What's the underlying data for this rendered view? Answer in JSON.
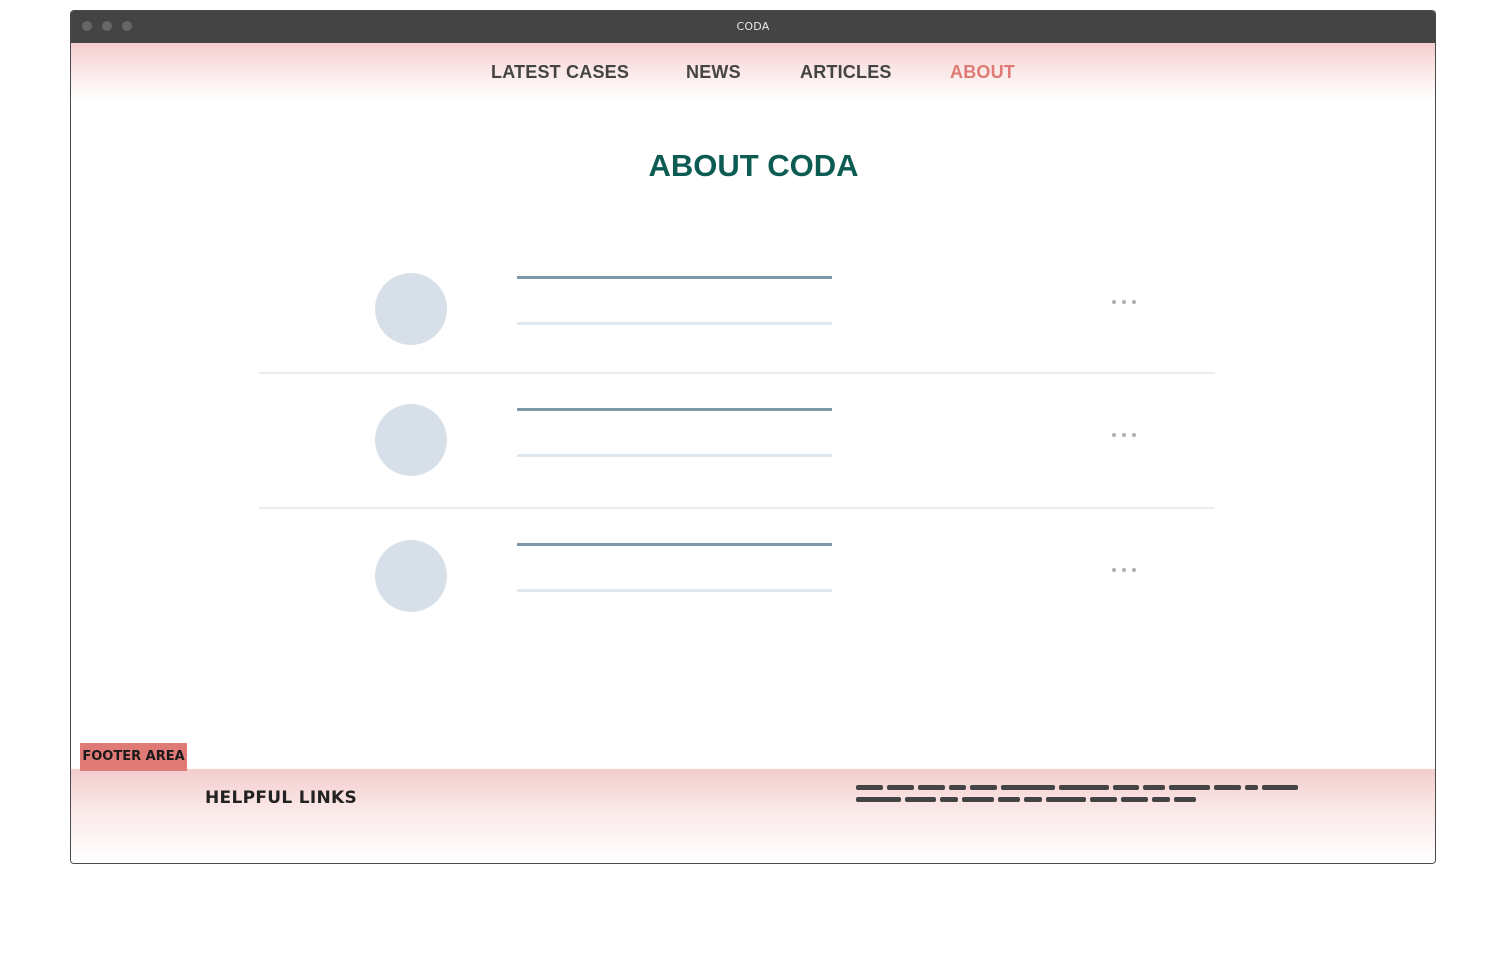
{
  "window": {
    "title": "CODA"
  },
  "nav": {
    "items": [
      {
        "label": "LATEST CASES",
        "active": false
      },
      {
        "label": "NEWS",
        "active": false
      },
      {
        "label": "ARTICLES",
        "active": false
      },
      {
        "label": "ABOUT",
        "active": true
      }
    ]
  },
  "main": {
    "title": "ABOUT CODA",
    "rows": [
      {
        "avatar": "placeholder-avatar",
        "title_line": "placeholder-line",
        "subtitle_line": "placeholder-line",
        "action_icon": "more-horizontal-icon"
      },
      {
        "avatar": "placeholder-avatar",
        "title_line": "placeholder-line",
        "subtitle_line": "placeholder-line",
        "action_icon": "more-horizontal-icon"
      },
      {
        "avatar": "placeholder-avatar",
        "title_line": "placeholder-line",
        "subtitle_line": "placeholder-line",
        "action_icon": "more-horizontal-icon"
      }
    ]
  },
  "footer": {
    "area_label": "FOOTER AREA",
    "helpful_links_label": "HELPFUL LINKS",
    "placeholder_text": "scribble-text-placeholder"
  },
  "colors": {
    "titlebar": "#444444",
    "nav_active": "#e07a76",
    "nav_text": "#444444",
    "heading": "#0d5c54",
    "gradient_pink": "#f4cccc",
    "footer_tag": "#e07a76",
    "avatar": "#d7e0e8",
    "title_line": "#7d99a8",
    "subtitle_line": "#e0e8ef"
  }
}
